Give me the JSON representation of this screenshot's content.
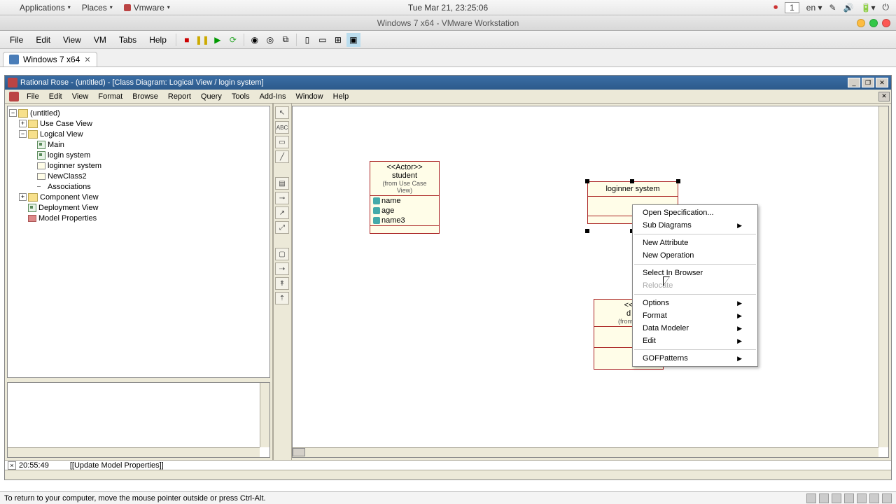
{
  "mac_menubar": {
    "apple": "",
    "items": [
      "Applications",
      "Places",
      "Vmware"
    ],
    "datetime": "Tue Mar 21, 23:25:06",
    "lang": "en",
    "indicator": "1"
  },
  "mac_window_title": "Windows 7 x64 - VMware Workstation",
  "vm_menubar": [
    "File",
    "Edit",
    "View",
    "VM",
    "Tabs",
    "Help"
  ],
  "vm_tab": {
    "label": "Windows 7 x64"
  },
  "rose": {
    "title": "Rational Rose - (untitled) - [Class Diagram: Logical View / login system]",
    "menubar": [
      "File",
      "Edit",
      "View",
      "Format",
      "Browse",
      "Report",
      "Query",
      "Tools",
      "Add-Ins",
      "Window",
      "Help"
    ],
    "tree": {
      "root": "(untitled)",
      "use_case": "Use Case View",
      "logical": "Logical View",
      "logical_children": [
        "Main",
        "login system",
        "loginner system",
        "NewClass2",
        "Associations"
      ],
      "component": "Component View",
      "deployment": "Deployment View",
      "model_props": "Model Properties"
    },
    "logrow": {
      "time": "20:55:49",
      "msg": "[[Update Model Properties]]"
    }
  },
  "uml": {
    "student": {
      "stereo": "<<Actor>>",
      "name": "student",
      "from": "(from Use Case View)",
      "attrs": [
        "name",
        "age",
        "name3"
      ]
    },
    "loginner": {
      "name": "loginner system"
    },
    "behind": {
      "stereo": "<<",
      "name": "d",
      "from": "(from U"
    }
  },
  "context_menu": {
    "items": [
      {
        "label": "Open Specification...",
        "arrow": false
      },
      {
        "label": "Sub Diagrams",
        "arrow": true
      },
      {
        "sep": true
      },
      {
        "label": "New Attribute",
        "arrow": false
      },
      {
        "label": "New Operation",
        "arrow": false
      },
      {
        "sep": true
      },
      {
        "label": "Select In Browser",
        "arrow": false
      },
      {
        "label": "Relocate",
        "arrow": false,
        "disabled": true
      },
      {
        "sep": true
      },
      {
        "label": "Options",
        "arrow": true
      },
      {
        "label": "Format",
        "arrow": true
      },
      {
        "label": "Data Modeler",
        "arrow": true
      },
      {
        "label": "Edit",
        "arrow": true
      },
      {
        "sep": true
      },
      {
        "label": "GOFPatterns",
        "arrow": true
      }
    ]
  },
  "vm_status": "To return to your computer, move the mouse pointer outside or press Ctrl-Alt."
}
